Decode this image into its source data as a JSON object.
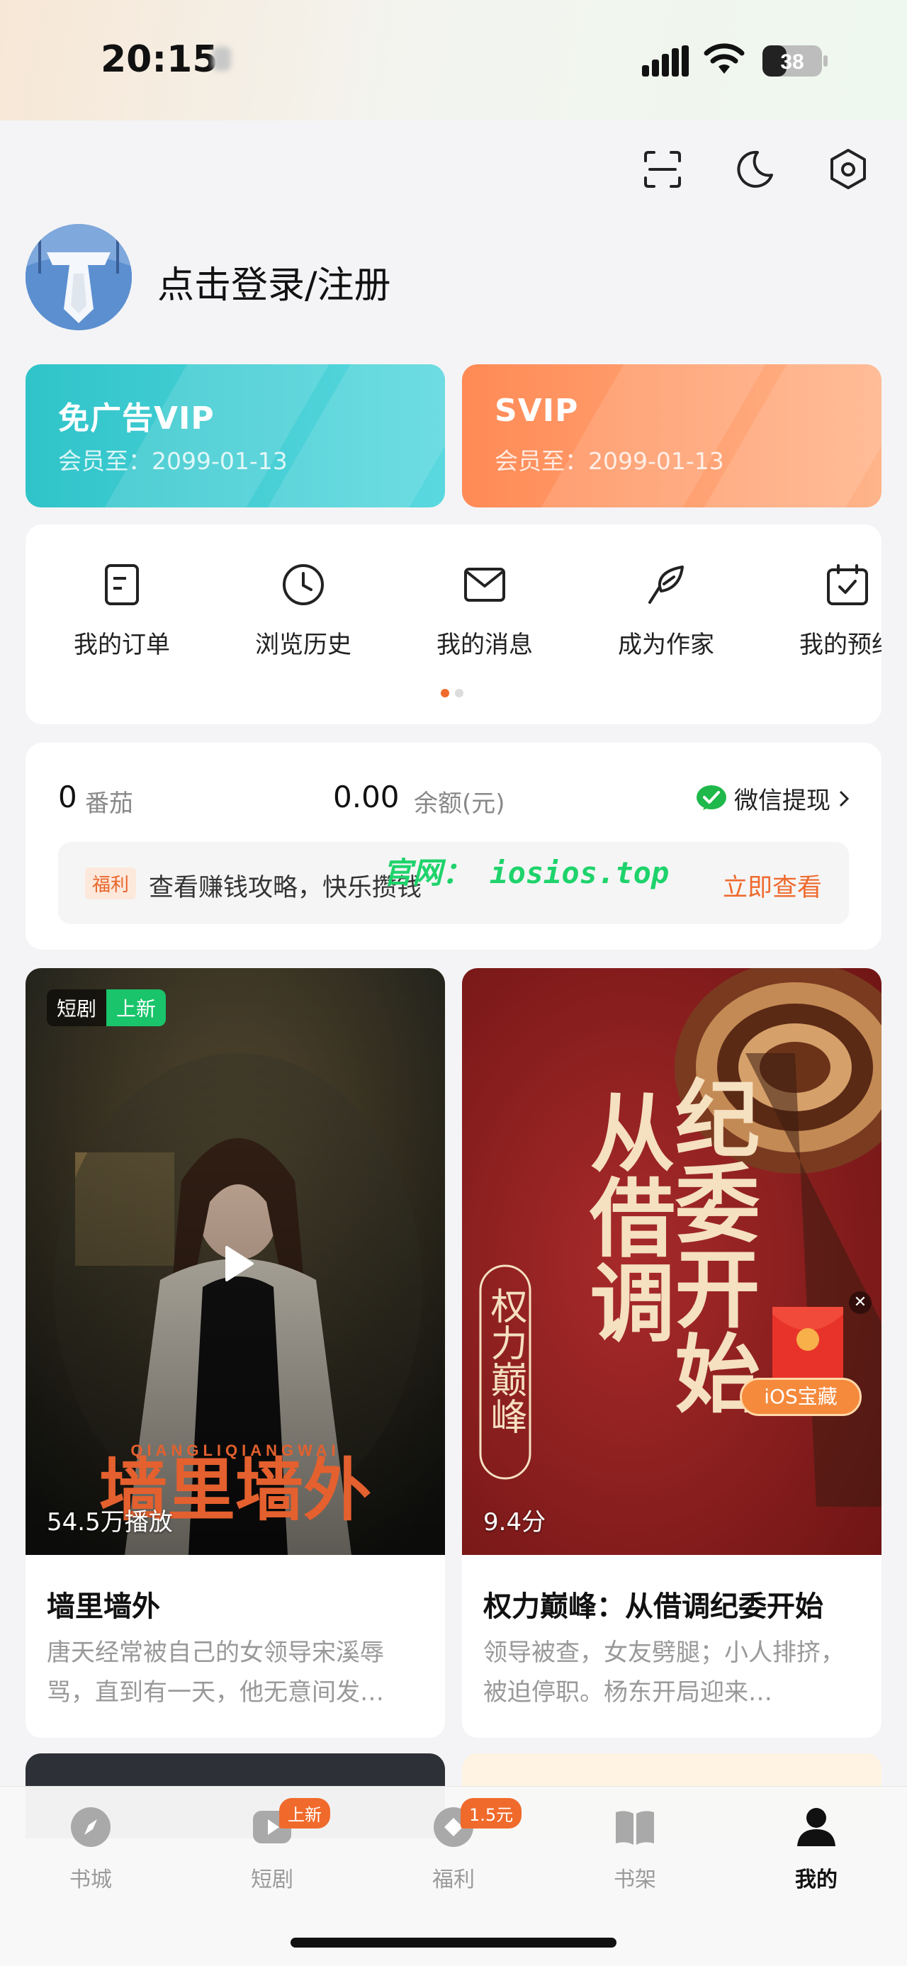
{
  "status_bar": {
    "time": "20:15",
    "battery": "38"
  },
  "profile": {
    "login_text": "点击登录/注册"
  },
  "vip_cards": [
    {
      "title": "免广告VIP",
      "subtitle": "会员至：2099-01-13",
      "color": "#2fc4c9"
    },
    {
      "title": "SVIP",
      "subtitle": "会员至：2099-01-13",
      "color": "#ff8a55"
    }
  ],
  "quick_actions": [
    {
      "label": "我的订单",
      "icon": "order-icon"
    },
    {
      "label": "浏览历史",
      "icon": "clock-icon"
    },
    {
      "label": "我的消息",
      "icon": "mail-icon"
    },
    {
      "label": "成为作家",
      "icon": "quill-icon"
    },
    {
      "label": "我的预约",
      "icon": "calendar-check-icon"
    }
  ],
  "wallet": {
    "tomato_count": "0",
    "tomato_label": "番茄",
    "balance": "0.00",
    "balance_label": "余额(元)",
    "withdraw_label": "微信提现",
    "tip_tag": "福利",
    "tip_text": "查看赚钱攻略，快乐攒钱",
    "tip_link": "立即查看",
    "watermark": "官网： iosios.top"
  },
  "cards": [
    {
      "tag_type": "短剧",
      "tag_new": "上新",
      "stat": "54.5万播放",
      "cover_title": "墙里墙外",
      "cover_subtitle": "QIANGLIQIANGWAI",
      "title": "墙里墙外",
      "desc": "唐天经常被自己的女领导宋溪辱骂，直到有一天，他无意间发…"
    },
    {
      "stat": "9.4分",
      "cover_title_1": "从借调",
      "cover_title_2": "纪委开始",
      "cover_small": "权力巅峰",
      "ad_label": "iOS宝藏",
      "title": "权力巅峰：从借调纪委开始",
      "desc": "领导被查，女友劈腿；小人排挤，被迫停职。杨东开局迎来…"
    }
  ],
  "tabbar": [
    {
      "label": "书城",
      "icon": "compass-icon",
      "badge": ""
    },
    {
      "label": "短剧",
      "icon": "video-icon",
      "badge": "上新"
    },
    {
      "label": "福利",
      "icon": "coin-icon",
      "badge": "1.5元"
    },
    {
      "label": "书架",
      "icon": "book-icon",
      "badge": ""
    },
    {
      "label": "我的",
      "icon": "person-icon",
      "badge": "",
      "active": true
    }
  ],
  "colors": {
    "accent": "#f06a2b",
    "green": "#19c46a",
    "vip_teal": "#2fc4c9",
    "svip_orange": "#ff8a55"
  }
}
